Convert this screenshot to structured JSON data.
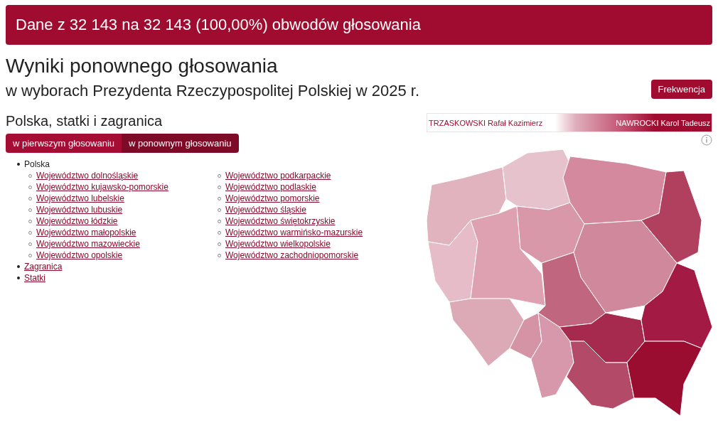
{
  "banner": {
    "text": "Dane z 32 143 na 32 143 (100,00%) obwodów głosowania"
  },
  "header": {
    "title": "Wyniki ponownego głosowania",
    "subtitle": "w wyborach Prezydenta Rzeczypospolitej Polskiej w 2025 r.",
    "button": "Frekwencja"
  },
  "section": {
    "title": "Polska, statki i zagranica",
    "tabs": [
      {
        "label": "w pierwszym głosowaniu",
        "selected": false
      },
      {
        "label": "w ponownym głosowaniu",
        "selected": true
      }
    ],
    "tree": [
      {
        "label": "Polska",
        "link": false,
        "children": [
          {
            "label": "Województwo dolnośląskie"
          },
          {
            "label": "Województwo kujawsko-pomorskie"
          },
          {
            "label": "Województwo lubelskie"
          },
          {
            "label": "Województwo lubuskie"
          },
          {
            "label": "Województwo łódzkie"
          },
          {
            "label": "Województwo małopolskie"
          },
          {
            "label": "Województwo mazowieckie"
          },
          {
            "label": "Województwo opolskie"
          },
          {
            "label": "Województwo podkarpackie"
          },
          {
            "label": "Województwo podlaskie"
          },
          {
            "label": "Województwo pomorskie"
          },
          {
            "label": "Województwo śląskie"
          },
          {
            "label": "Województwo świętokrzyskie"
          },
          {
            "label": "Województwo warmińsko-mazurskie"
          },
          {
            "label": "Województwo wielkopolskie"
          },
          {
            "label": "Województwo zachodniopomorskie"
          }
        ]
      },
      {
        "label": "Zagranica",
        "link": true
      },
      {
        "label": "Statki",
        "link": true
      }
    ]
  },
  "legend": {
    "left": "TRZASKOWSKI Rafał Kazimierz",
    "right": "NAWROCKI Karol Tadeusz"
  }
}
